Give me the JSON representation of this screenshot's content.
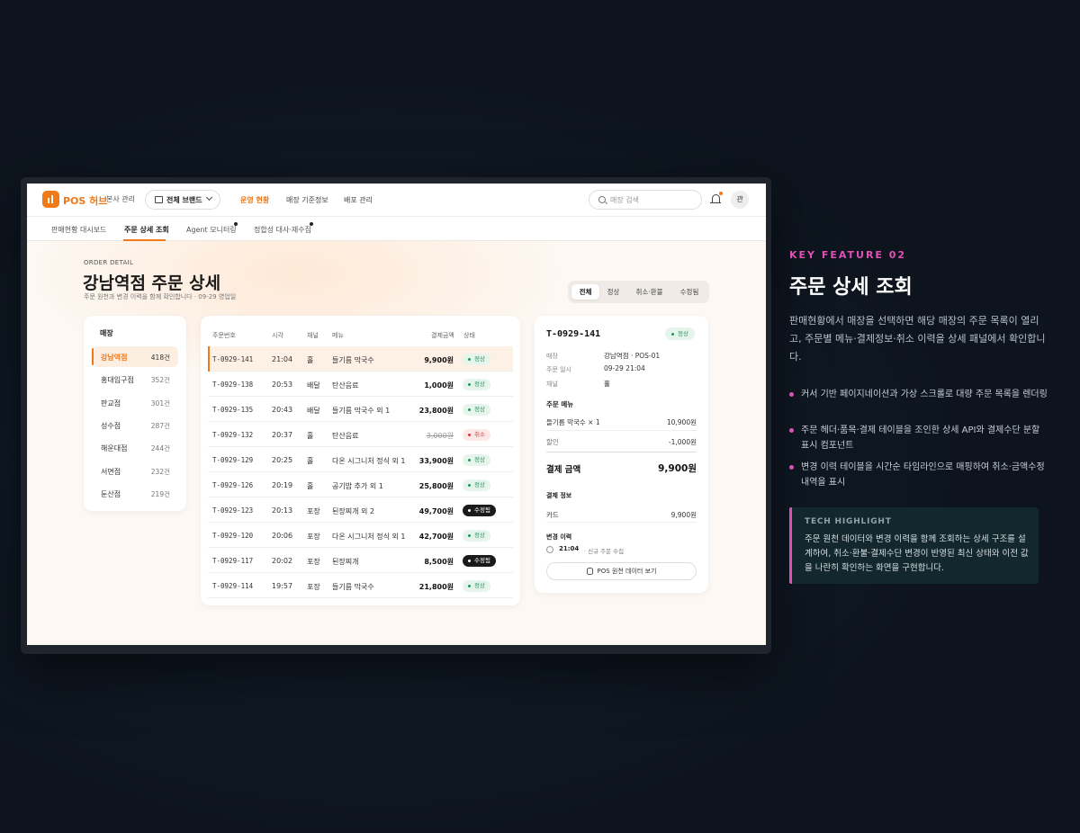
{
  "app": {
    "brand": "POS 허브",
    "hq_label": "본사 관리",
    "brand_select": "전체 브랜드",
    "nav": [
      "운영 현황",
      "매장 기준정보",
      "배포 관리"
    ],
    "search_placeholder": "매장 검색",
    "avatar": "관"
  },
  "subtabs": [
    "판매현황 대시보드",
    "주문 상세 조회",
    "Agent 모니터링",
    "정합성 대사·재수집"
  ],
  "page": {
    "eyebrow": "ORDER DETAIL",
    "title": "강남역점 주문 상세",
    "subtitle": "주문 원천과 변경 이력을 함께 확인합니다 · 09-29 영업일",
    "filters": [
      "전체",
      "정상",
      "취소·환불",
      "수정됨"
    ]
  },
  "stores": {
    "title": "매장",
    "items": [
      {
        "name": "강남역점",
        "count": "418건"
      },
      {
        "name": "홍대입구점",
        "count": "352건"
      },
      {
        "name": "판교점",
        "count": "301건"
      },
      {
        "name": "성수점",
        "count": "287건"
      },
      {
        "name": "해운대점",
        "count": "244건"
      },
      {
        "name": "서면점",
        "count": "232건"
      },
      {
        "name": "둔산점",
        "count": "219건"
      }
    ]
  },
  "orders": {
    "headers": [
      "주문번호",
      "시각",
      "채널",
      "메뉴",
      "결제금액",
      "상태"
    ],
    "rows": [
      {
        "id": "T-0929-141",
        "time": "21:04",
        "channel": "홀",
        "menu": "들기름 막국수",
        "amount": "9,900원",
        "status": "정상"
      },
      {
        "id": "T-0929-138",
        "time": "20:53",
        "channel": "배달",
        "menu": "탄산음료",
        "amount": "1,000원",
        "status": "정상"
      },
      {
        "id": "T-0929-135",
        "time": "20:43",
        "channel": "배달",
        "menu": "들기름 막국수 외 1",
        "amount": "23,800원",
        "status": "정상"
      },
      {
        "id": "T-0929-132",
        "time": "20:37",
        "channel": "홀",
        "menu": "탄산음료",
        "amount": "3,000원",
        "status": "취소"
      },
      {
        "id": "T-0929-129",
        "time": "20:25",
        "channel": "홀",
        "menu": "다온 시그니처 정식 외 1",
        "amount": "33,900원",
        "status": "정상"
      },
      {
        "id": "T-0929-126",
        "time": "20:19",
        "channel": "홀",
        "menu": "공기밥 추가 외 1",
        "amount": "25,800원",
        "status": "정상"
      },
      {
        "id": "T-0929-123",
        "time": "20:13",
        "channel": "포장",
        "menu": "된장찌개 외 2",
        "amount": "49,700원",
        "status": "수정됨"
      },
      {
        "id": "T-0929-120",
        "time": "20:06",
        "channel": "포장",
        "menu": "다온 시그니처 정식 외 1",
        "amount": "42,700원",
        "status": "정상"
      },
      {
        "id": "T-0929-117",
        "time": "20:02",
        "channel": "포장",
        "menu": "된장찌개",
        "amount": "8,500원",
        "status": "수정됨"
      },
      {
        "id": "T-0929-114",
        "time": "19:57",
        "channel": "포장",
        "menu": "들기름 막국수",
        "amount": "21,800원",
        "status": "정상"
      }
    ]
  },
  "detail": {
    "id": "T-0929-141",
    "status": "정상",
    "meta": [
      {
        "k": "매장",
        "v": "강남역점 · POS-01"
      },
      {
        "k": "주문 일시",
        "v": "09-29 21:04"
      },
      {
        "k": "채널",
        "v": "홀"
      }
    ],
    "menu_title": "주문 메뉴",
    "items": [
      {
        "name": "들기름 막국수 × 1",
        "amount": "10,900원"
      },
      {
        "name": "할인",
        "amount": "-1,000원"
      }
    ],
    "total_label": "결제 금액",
    "total": "9,900원",
    "payment_title": "결제 정보",
    "payment": {
      "method": "카드",
      "amount": "9,900원"
    },
    "history_title": "변경 이력",
    "history": {
      "time": "21:04",
      "text": "· 신규 주문 수집"
    },
    "raw_button": "POS 원천 데이터 보기"
  },
  "feature": {
    "kicker": "KEY FEATURE 02",
    "title": "주문 상세 조회",
    "desc": "판매현황에서 매장을 선택하면 해당 매장의 주문 목록이 열리고, 주문별 메뉴·결제정보·취소 이력을 상세 패널에서 확인합니다.",
    "bullets": [
      "커서 기반 페이지네이션과 가상 스크롤로 대량 주문 목록을 렌더링",
      "주문 헤더·품목·결제 테이블을 조인한 상세 API와 결제수단 분할 표시 컴포넌트",
      "변경 이력 테이블을 시간순 타임라인으로 매핑하여 취소·금액수정 내역을 표시"
    ],
    "tech_title": "TECH HIGHLIGHT",
    "tech_body": "주문 원천 데이터와 변경 이력을 함께 조회하는 상세 구조를 설계하여, 취소·환불·결제수단 변경이 반영된 최신 상태와 이전 값을 나란히 확인하는 화면을 구현합니다."
  }
}
